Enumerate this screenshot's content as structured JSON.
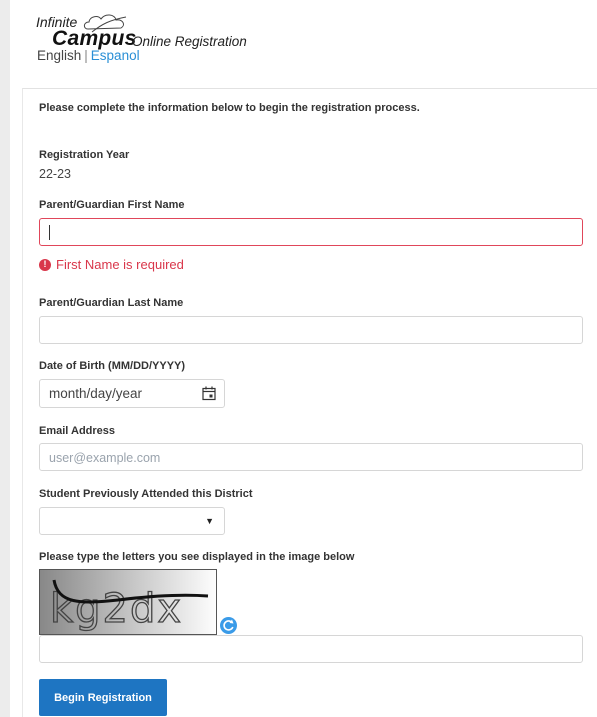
{
  "header": {
    "logo_line1": "Infinite",
    "logo_line2": "Campus",
    "subtitle": "Online Registration",
    "lang_english": "English",
    "lang_separator": "|",
    "lang_espanol": "Espanol"
  },
  "form": {
    "intro": "Please complete the information below to begin the registration process.",
    "reg_year_label": "Registration Year",
    "reg_year_value": "22-23",
    "first_name_label": "Parent/Guardian First Name",
    "first_name_value": "",
    "first_name_error": "First Name is required",
    "last_name_label": "Parent/Guardian Last Name",
    "last_name_value": "",
    "dob_label": "Date of Birth (MM/DD/YYYY)",
    "dob_placeholder": "month/day/year",
    "email_label": "Email Address",
    "email_placeholder": "user@example.com",
    "attended_label": "Student Previously Attended this District",
    "attended_value": "",
    "captcha_label": "Please type the letters you see displayed in the image below",
    "captcha_text": "kg2dx",
    "captcha_value": "",
    "submit_label": "Begin Registration"
  },
  "colors": {
    "accent": "#1e75c2",
    "link": "#2a8fd6",
    "error": "#d9374b"
  },
  "icons": {
    "calendar": "calendar-icon",
    "error": "error-icon",
    "refresh": "refresh-icon",
    "dropdown": "chevron-down-icon"
  }
}
